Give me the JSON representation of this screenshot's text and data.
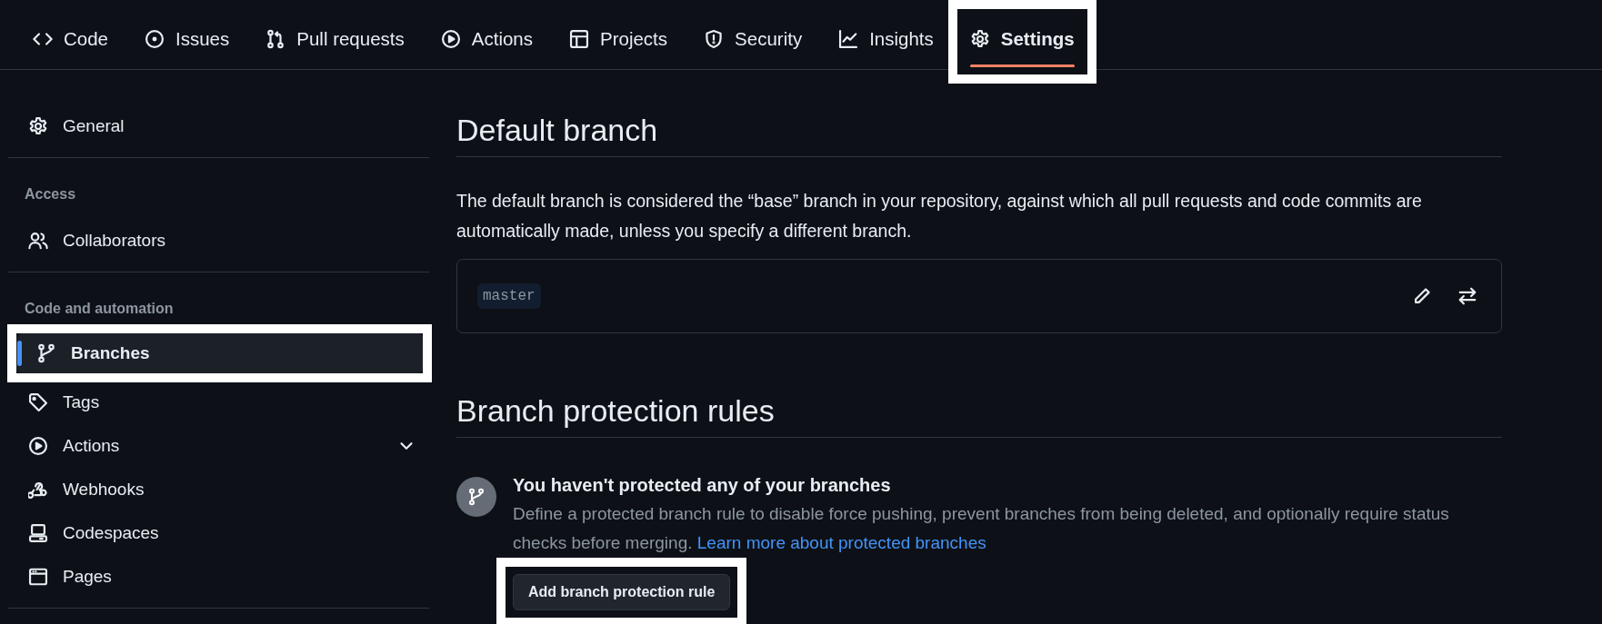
{
  "tabs": [
    {
      "label": "Code",
      "selected": false,
      "highlighted": false
    },
    {
      "label": "Issues",
      "selected": false,
      "highlighted": false
    },
    {
      "label": "Pull requests",
      "selected": false,
      "highlighted": false
    },
    {
      "label": "Actions",
      "selected": false,
      "highlighted": false
    },
    {
      "label": "Projects",
      "selected": false,
      "highlighted": false
    },
    {
      "label": "Security",
      "selected": false,
      "highlighted": false
    },
    {
      "label": "Insights",
      "selected": false,
      "highlighted": false
    },
    {
      "label": "Settings",
      "selected": true,
      "highlighted": true
    }
  ],
  "sidebar": {
    "items": [
      {
        "kind": "item",
        "label": "General",
        "selected": false,
        "highlighted": false
      },
      {
        "kind": "heading",
        "label": "Access"
      },
      {
        "kind": "item",
        "label": "Collaborators",
        "selected": false,
        "highlighted": false
      },
      {
        "kind": "heading",
        "label": "Code and automation"
      },
      {
        "kind": "item",
        "label": "Branches",
        "selected": true,
        "highlighted": true
      },
      {
        "kind": "item",
        "label": "Tags",
        "selected": false,
        "highlighted": false
      },
      {
        "kind": "item",
        "label": "Actions",
        "selected": false,
        "highlighted": false,
        "expanded": false
      },
      {
        "kind": "item",
        "label": "Webhooks",
        "selected": false,
        "highlighted": false
      },
      {
        "kind": "item",
        "label": "Codespaces",
        "selected": false,
        "highlighted": false
      },
      {
        "kind": "item",
        "label": "Pages",
        "selected": false,
        "highlighted": false
      }
    ]
  },
  "default_branch": {
    "heading": "Default branch",
    "description": "The default branch is considered the “base” branch in your repository, against which all pull requests and code commits are automatically made, unless you specify a different branch.",
    "branch": "master"
  },
  "branch_protection": {
    "heading": "Branch protection rules",
    "empty_title": "You haven't protected any of your branches",
    "empty_text": "Define a protected branch rule to disable force pushing, prevent branches from being deleted, and optionally require status checks before merging.",
    "link": "Learn more about protected branches",
    "button": {
      "label": "Add branch protection rule",
      "highlighted": true
    }
  }
}
